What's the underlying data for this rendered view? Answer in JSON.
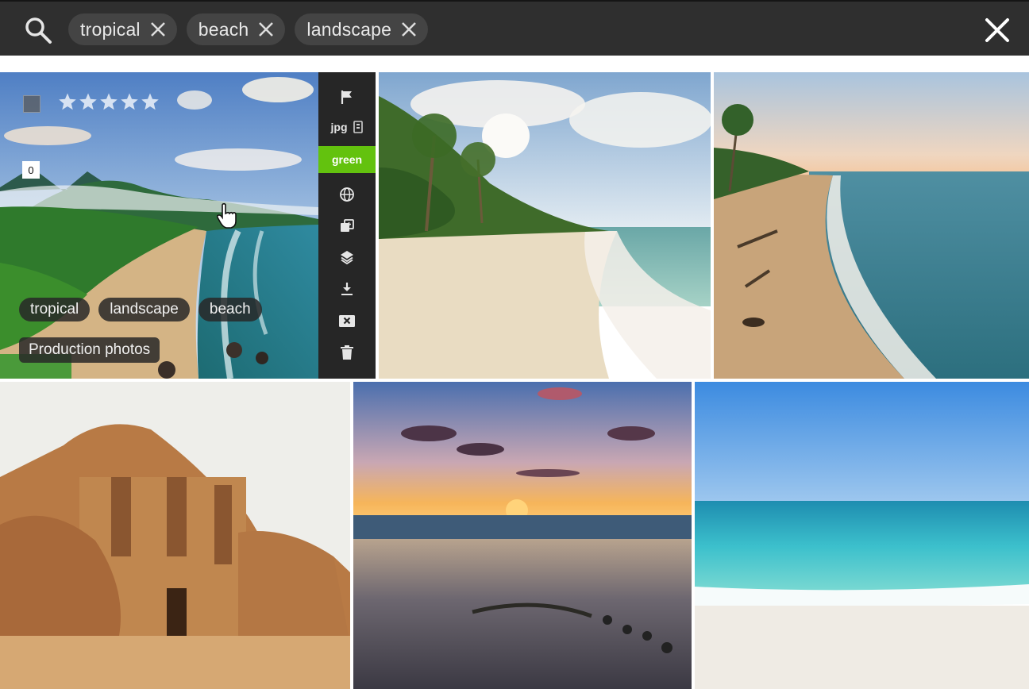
{
  "search": {
    "chips": [
      {
        "label": "tropical"
      },
      {
        "label": "beach"
      },
      {
        "label": "landscape"
      }
    ]
  },
  "hovered_photo": {
    "rating_stars": 5,
    "badge_count": "0",
    "tags": [
      "tropical",
      "landscape",
      "beach"
    ],
    "album": "Production photos",
    "toolbar": {
      "format": "jpg",
      "color_label": "green",
      "color_label_color": "#63c20e",
      "icons": [
        "flag-icon",
        "raw-file-icon",
        "globe-icon",
        "copy-icon",
        "stack-icon",
        "download-icon",
        "archive-icon",
        "trash-icon"
      ]
    }
  },
  "grid": {
    "photos": [
      {
        "subject": "tropical-coast-mountains"
      },
      {
        "subject": "palm-beach-footprints"
      },
      {
        "subject": "sunset-shoreline"
      },
      {
        "subject": "desert-temple"
      },
      {
        "subject": "sunset-beach-rocks"
      },
      {
        "subject": "turquoise-sea"
      }
    ]
  }
}
